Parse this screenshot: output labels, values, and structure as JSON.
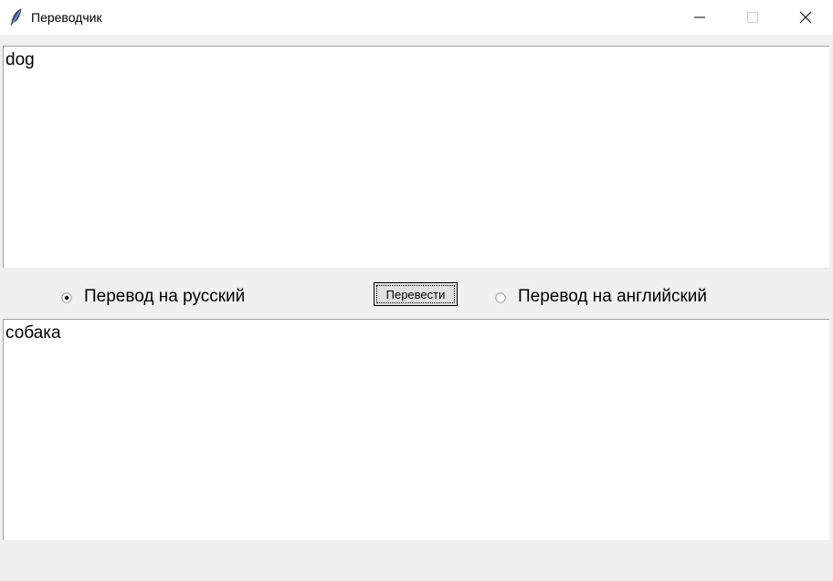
{
  "window": {
    "title": "Переводчик",
    "icon": "feather-icon"
  },
  "input": {
    "value": "dog"
  },
  "options": {
    "to_russian": {
      "label": "Перевод на русский",
      "selected": true
    },
    "to_english": {
      "label": "Перевод на английский",
      "selected": false
    }
  },
  "actions": {
    "translate_label": "Перевести"
  },
  "output": {
    "value": "собака"
  }
}
